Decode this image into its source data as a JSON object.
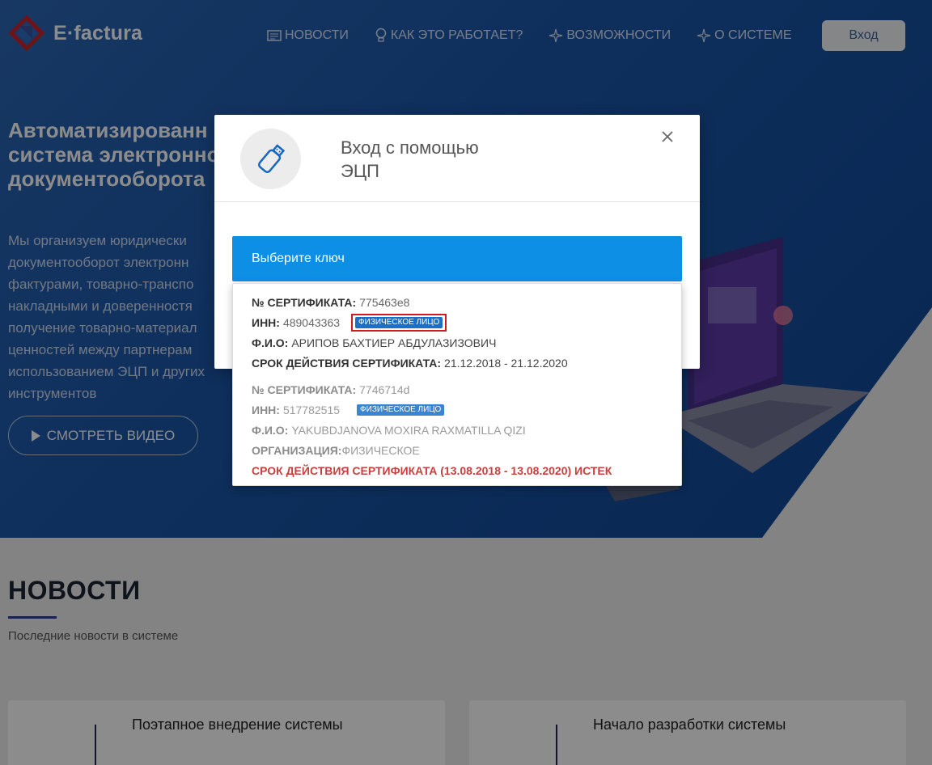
{
  "brand": {
    "logo_text": "E·factura"
  },
  "nav": {
    "items": [
      {
        "label": "НОВОСТИ",
        "icon": "newspaper-icon"
      },
      {
        "label": "КАК ЭТО РАБОТАЕТ?",
        "icon": "lightbulb-icon"
      },
      {
        "label": "ВОЗМОЖНОСТИ",
        "icon": "sparkle-icon"
      },
      {
        "label": "О СИСТЕМЕ",
        "icon": "sparkle-icon"
      }
    ],
    "login_label": "Вход"
  },
  "hero": {
    "title": "Автоматизированн\nсистема электронно\nдокументооборота",
    "text": "Мы организуем юридически\nдокументооборот электронн\nфактурами, товарно-транспо\nнакладными и доверенностя\nполучение товарно-материал\nценностей между партнерам\nиспользованием ЭЦП и других\nинструментов",
    "video_button": "СМОТРЕТЬ ВИДЕО"
  },
  "news": {
    "title": "НОВОСТИ",
    "subtitle": "Последние новости в системе",
    "cards": [
      {
        "title": "Поэтапное внедрение системы"
      },
      {
        "title": "Начало разработки системы"
      }
    ]
  },
  "modal": {
    "title": "Вход с помощью\nЭЦП",
    "close_icon": "close-icon",
    "select_label": "Выберите ключ",
    "certificates": [
      {
        "cert_label": "№ СЕРТИФИКАТА:",
        "cert_number": "775463e8",
        "inn_label": "ИНН:",
        "inn": "489043363",
        "badge": "ФИЗИЧЕСКОЕ ЛИЦО",
        "fio_label": "Ф.И.О:",
        "fio": "АРИПОВ БАХТИЕР АБДУЛАЗИЗОВИЧ",
        "validity_label": "СРОК ДЕЙСТВИЯ СЕРТИФИКАТА:",
        "validity": "21.12.2018 - 21.12.2020"
      },
      {
        "cert_label": "№ СЕРТИФИКАТА:",
        "cert_number": "7746714d",
        "inn_label": "ИНН:",
        "inn": "517782515",
        "badge": "ФИЗИЧЕСКОЕ ЛИЦО",
        "fio_label": "Ф.И.О:",
        "fio": "YAKUBDJANOVA MOXIRA RAXMATILLA QIZI",
        "org_label": "ОРГАНИЗАЦИЯ:",
        "org": "ФИЗИЧЕСКОЕ",
        "expired_text": "СРОК ДЕЙСТВИЯ СЕРТИФИКАТА (13.08.2018 - 13.08.2020) ИСТЕК"
      }
    ]
  },
  "colors": {
    "hero_blue": "#1b56a8",
    "select_blue": "#0c8fe5",
    "badge_blue": "#1a6fc9",
    "expired_red": "#c21d1d",
    "highlight_red": "#cf1c1c"
  }
}
